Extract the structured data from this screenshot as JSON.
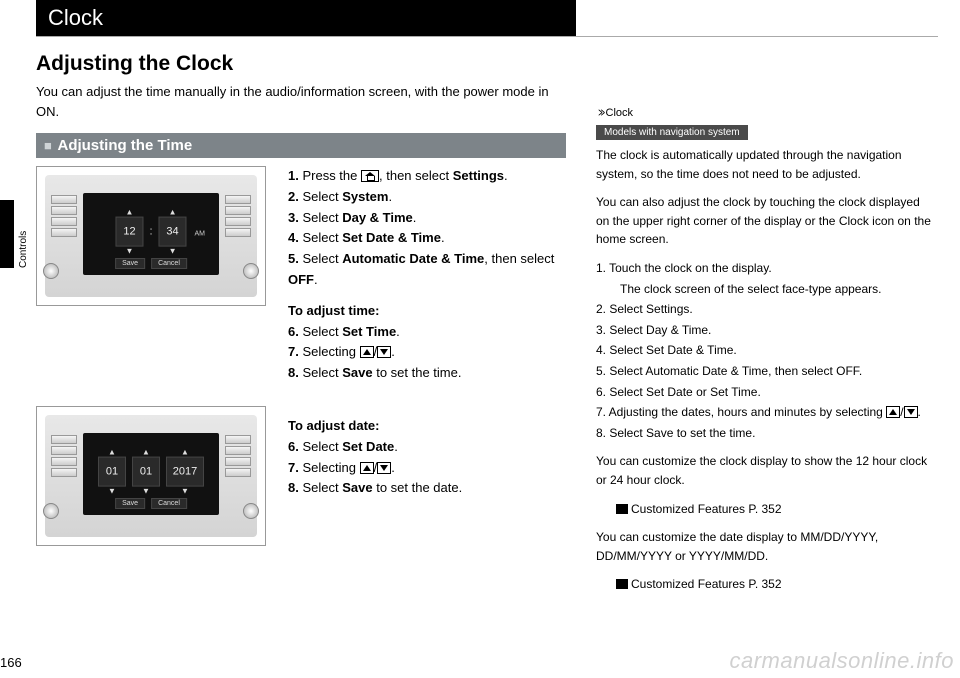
{
  "meta": {
    "chapter_tab": "Controls",
    "page_number": "166",
    "watermark": "carmanualsonline.info"
  },
  "header": {
    "title": "Clock"
  },
  "left": {
    "section_title": "Adjusting the Clock",
    "intro": "You can adjust the time manually in the audio/information screen, with the power mode in ON.",
    "subhead": "Adjusting the Time",
    "figure_time": {
      "hour": "12",
      "minute": "34",
      "ampm": "AM",
      "save": "Save",
      "cancel": "Cancel"
    },
    "figure_date": {
      "month": "01",
      "day": "01",
      "year": "2017",
      "save": "Save",
      "cancel": "Cancel"
    },
    "steps_main": {
      "s1a": "1.",
      "s1b": "Press the ",
      "s1c": ", then select ",
      "s1d": "Settings",
      "s1e": ".",
      "s2a": "2.",
      "s2b": "Select ",
      "s2c": "System",
      "s2d": ".",
      "s3a": "3.",
      "s3b": "Select ",
      "s3c": "Day & Time",
      "s3d": ".",
      "s4a": "4.",
      "s4b": "Select ",
      "s4c": "Set Date & Time",
      "s4d": ".",
      "s5a": "5.",
      "s5b": "Select ",
      "s5c": "Automatic Date & Time",
      "s5d": ", then select ",
      "s5e": "OFF",
      "s5f": "."
    },
    "steps_time": {
      "hdr": "To adjust time:",
      "s6a": "6.",
      "s6b": "Select ",
      "s6c": "Set Time",
      "s6d": ".",
      "s7a": "7.",
      "s7b": "Selecting ",
      "s7c": "/",
      "s7d": ".",
      "s8a": "8.",
      "s8b": "Select ",
      "s8c": "Save",
      "s8d": " to set the time."
    },
    "steps_date": {
      "hdr": "To adjust date:",
      "s6a": "6.",
      "s6b": "Select ",
      "s6c": "Set Date",
      "s6d": ".",
      "s7a": "7.",
      "s7b": "Selecting ",
      "s7c": "/",
      "s7d": ".",
      "s8a": "8.",
      "s8b": "Select ",
      "s8c": "Save",
      "s8d": " to set the date."
    }
  },
  "right": {
    "crumb": "Clock",
    "badge": "Models with navigation system",
    "para1": "The clock is automatically updated through the navigation system, so the time does not need to be adjusted.",
    "para2a": "You can also adjust the clock by touching the clock displayed on the upper right corner of the display or the ",
    "para2b": "Clock",
    "para2c": " icon on the home screen.",
    "list": {
      "l1": "1. Touch the clock on the display.",
      "l1sub": "The clock screen of the select face-type appears.",
      "l2a": "2. Select ",
      "l2b": "Settings",
      "l2c": ".",
      "l3a": "3. Select ",
      "l3b": "Day & Time",
      "l3c": ".",
      "l4a": "4. Select ",
      "l4b": "Set Date & Time",
      "l4c": ".",
      "l5a": "5. Select ",
      "l5b": "Automatic Date & Time",
      "l5c": ", then select ",
      "l5d": "OFF",
      "l5e": ".",
      "l6a": "6. Select ",
      "l6b": "Set Date",
      "l6c": " or ",
      "l6d": "Set Time",
      "l6e": ".",
      "l7a": "7. Adjusting the dates, hours and minutes by selecting ",
      "l7b": "/",
      "l7c": ".",
      "l8a": "8. Select ",
      "l8b": "Save",
      "l8c": " to set the time."
    },
    "para3": "You can customize the clock display to show the 12 hour clock or 24 hour clock.",
    "ref1a": "Customized Features",
    "ref1b": " P. 352",
    "para4": "You can customize the date display to MM/DD/YYYY, DD/MM/YYYY or YYYY/MM/DD.",
    "ref2a": "Customized Features",
    "ref2b": " P. 352"
  }
}
